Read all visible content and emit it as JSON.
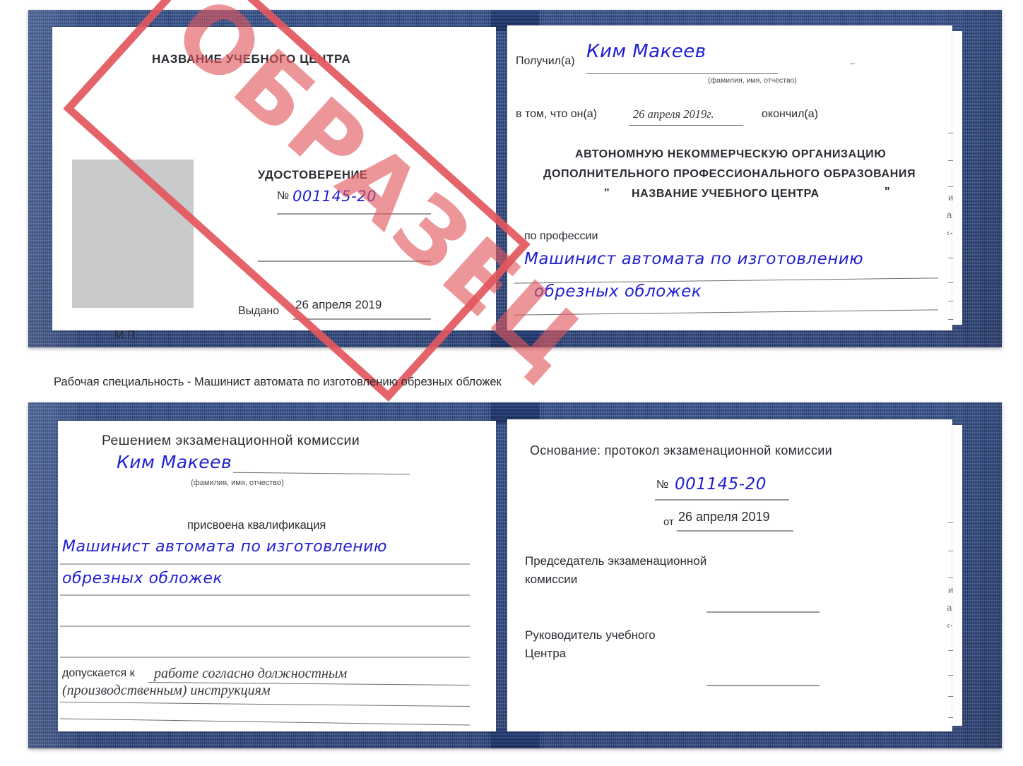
{
  "colors": {
    "cover_blue": "#2a4686",
    "stamp_red": "#e2575d",
    "ink_blue": "#1f1fd2",
    "paper_white": "#ffffff",
    "photo_gray": "#c9cacb",
    "rule_gray": "#9a9a9a"
  },
  "stamp": {
    "text": "ОБРАЗЕЦ"
  },
  "caption": "Рабочая специальность - Машинист автомата по изготовлению обрезных обложек",
  "certificate_front": {
    "left_page": {
      "center_name": "НАЗВАНИЕ УЧЕБНОГО ЦЕНТРА",
      "doc_title": "УДОСТОВЕРЕНИЕ",
      "number_label": "№",
      "number_value": "001145-20",
      "issued_label": "Выдано",
      "issued_date": "26 апреля 2019",
      "seal_label": "М.П."
    },
    "right_page": {
      "received_label": "Получил(а)",
      "received_name": "Ким Макеев",
      "name_hint": "(фамилия, имя, отчество)",
      "in_that_label": "в том, что он(а)",
      "completed_date": "26 апреля 2019г.",
      "finished_label": "окончил(а)",
      "org_line_1": "АВТОНОМНУЮ НЕКОММЕРЧЕСКУЮ ОРГАНИЗАЦИЮ",
      "org_line_2": "ДОПОЛНИТЕЛЬНОГО ПРОФЕССИОНАЛЬНОГО ОБРАЗОВАНИЯ",
      "org_quote_open": "\"",
      "org_line_3": "НАЗВАНИЕ УЧЕБНОГО ЦЕНТРА",
      "org_quote_close": "\"",
      "profession_label": "по профессии",
      "profession_line_1": "Машинист автомата по изготовлению",
      "profession_line_2": "обрезных обложек"
    }
  },
  "certificate_back": {
    "left_page": {
      "heading": "Решением экзаменационной комиссии",
      "name": "Ким Макеев",
      "name_hint": "(фамилия, имя, отчество)",
      "qualification_label": "присвоена квалификация",
      "qualification_line_1": "Машинист автомата по изготовлению",
      "qualification_line_2": "обрезных обложек",
      "allowed_label": "допускается к",
      "allowed_value_1": "работе согласно должностным",
      "allowed_value_2": "(производственным) инструкциям"
    },
    "right_page": {
      "basis_label": "Основание: протокол экзаменационной комиссии",
      "number_label": "№",
      "number_value": "001145-20",
      "date_label": "от",
      "date_value": "26 апреля 2019",
      "chairman_line_1": "Председатель экзаменационной",
      "chairman_line_2": "комиссии",
      "director_line_1": "Руководитель учебного",
      "director_line_2": "Центра"
    }
  },
  "edge_ticks_top": [
    "–",
    "–",
    "–",
    "и",
    "a",
    "‹-",
    "–",
    "–",
    "–",
    "–"
  ],
  "edge_ticks_bottom": [
    "–",
    "–",
    "–",
    "и",
    "a",
    "‹-",
    "–",
    "–",
    "–",
    "–"
  ]
}
